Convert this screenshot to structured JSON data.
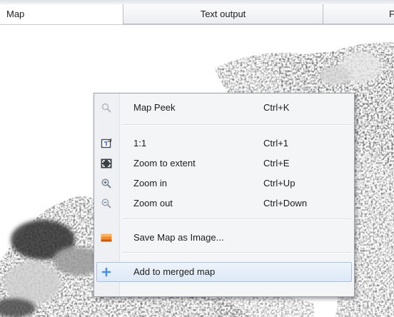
{
  "tabs": [
    {
      "label": "Map",
      "active": true
    },
    {
      "label": "Text output",
      "active": false
    },
    {
      "label": "F",
      "active": false
    }
  ],
  "context_menu": {
    "items": [
      {
        "label": "Map Peek",
        "shortcut": "Ctrl+K",
        "icon": "magnifier-icon",
        "enabled": false
      },
      {
        "label": "1:1",
        "shortcut": "Ctrl+1",
        "icon": "one-to-one-icon"
      },
      {
        "label": "Zoom to extent",
        "shortcut": "Ctrl+E",
        "icon": "zoom-extent-icon"
      },
      {
        "label": "Zoom in",
        "shortcut": "Ctrl+Up",
        "icon": "zoom-in-icon"
      },
      {
        "label": "Zoom out",
        "shortcut": "Ctrl+Down",
        "icon": "zoom-out-icon"
      },
      {
        "label": "Save Map as Image...",
        "shortcut": "",
        "icon": "save-image-icon"
      },
      {
        "label": "Add to merged map",
        "shortcut": "",
        "icon": "plus-icon",
        "highlighted": true
      }
    ]
  },
  "colors": {
    "menu_background": "#f4f5f7",
    "highlight_border": "#a9c3e3",
    "save_icon": "#e8731c",
    "plus_icon": "#4f8fd6"
  }
}
